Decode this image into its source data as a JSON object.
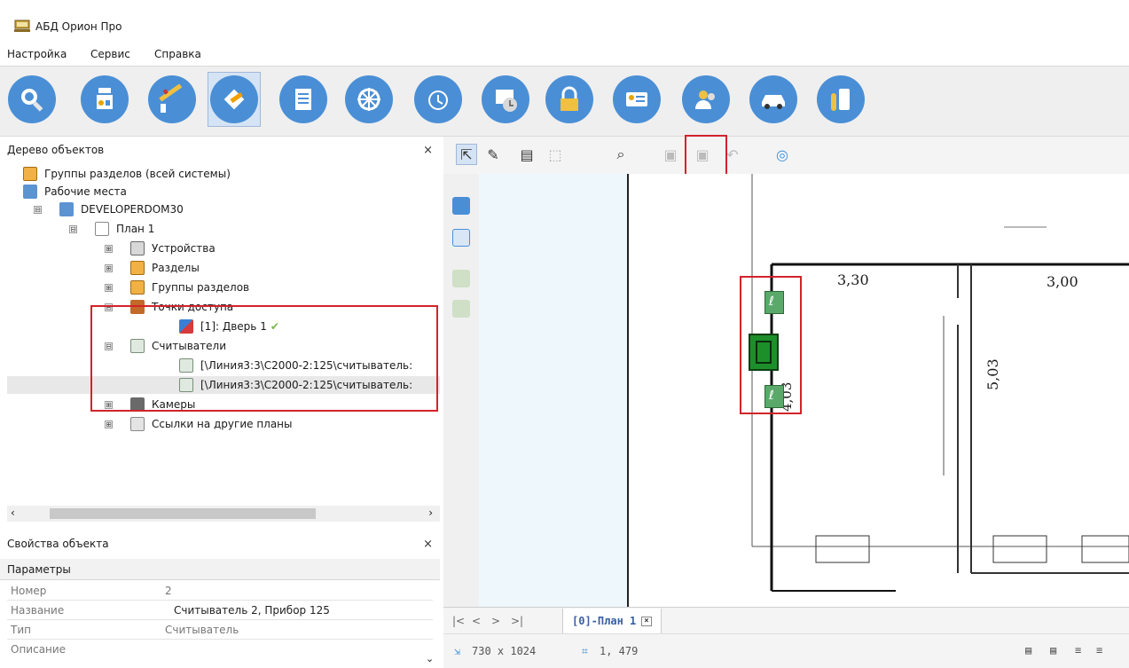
{
  "app": {
    "title": "АБД Орион Про"
  },
  "menu": [
    "Настройка",
    "Сервис",
    "Справка"
  ],
  "toolbar_icons": [
    "search-icon",
    "device-icon",
    "barrier-icon",
    "plan-editor-icon",
    "list-icon",
    "wheel-icon",
    "clock-icon",
    "schedule-icon",
    "lock-icon",
    "id-card-icon",
    "users-icon",
    "car-icon",
    "key-icon"
  ],
  "tree_panel": {
    "title": "Дерево объектов",
    "items": [
      {
        "label": "Группы разделов (всей системы)"
      },
      {
        "label": "Рабочие места"
      },
      {
        "label": "DEVELOPERDOM30",
        "expander": "⊟"
      },
      {
        "label": "План 1",
        "expander": "⊟"
      },
      {
        "label": "Устройства",
        "expander": "⊞"
      },
      {
        "label": "Разделы",
        "expander": "⊞"
      },
      {
        "label": "Группы разделов",
        "expander": "⊞"
      },
      {
        "label": "Точки доступа",
        "expander": "⊟"
      },
      {
        "label": "[1]: Дверь 1",
        "check": "✔"
      },
      {
        "label": "Считыватели",
        "expander": "⊟"
      },
      {
        "label": "[\\Линия3:3\\С2000-2:125\\считыватель:"
      },
      {
        "label": "[\\Линия3:3\\С2000-2:125\\считыватель:"
      },
      {
        "label": "Камеры",
        "expander": "⊞"
      },
      {
        "label": "Ссылки на другие планы",
        "expander": "⊞"
      }
    ]
  },
  "props_panel": {
    "title": "Свойства объекта",
    "section": "Параметры",
    "rows": [
      {
        "key": "Номер",
        "value": "2"
      },
      {
        "key": "Название",
        "value": "Считыватель 2, Прибор  125"
      },
      {
        "key": "Тип",
        "value": "Считыватель"
      },
      {
        "key": "Описание",
        "value": ""
      }
    ]
  },
  "plan": {
    "dims": [
      "3,30",
      "3,00",
      "5,03",
      "4,03"
    ]
  },
  "tabs": {
    "nav": [
      "|<",
      "<",
      ">",
      ">|"
    ],
    "active_tab": "[0]-План 1"
  },
  "status": {
    "size": "730 x 1024",
    "coords": "1, 479"
  },
  "colors": {
    "highlight": "#d2232a",
    "toolbar_blue": "#4a8fd6",
    "reader_green": "#2f8f3a"
  }
}
